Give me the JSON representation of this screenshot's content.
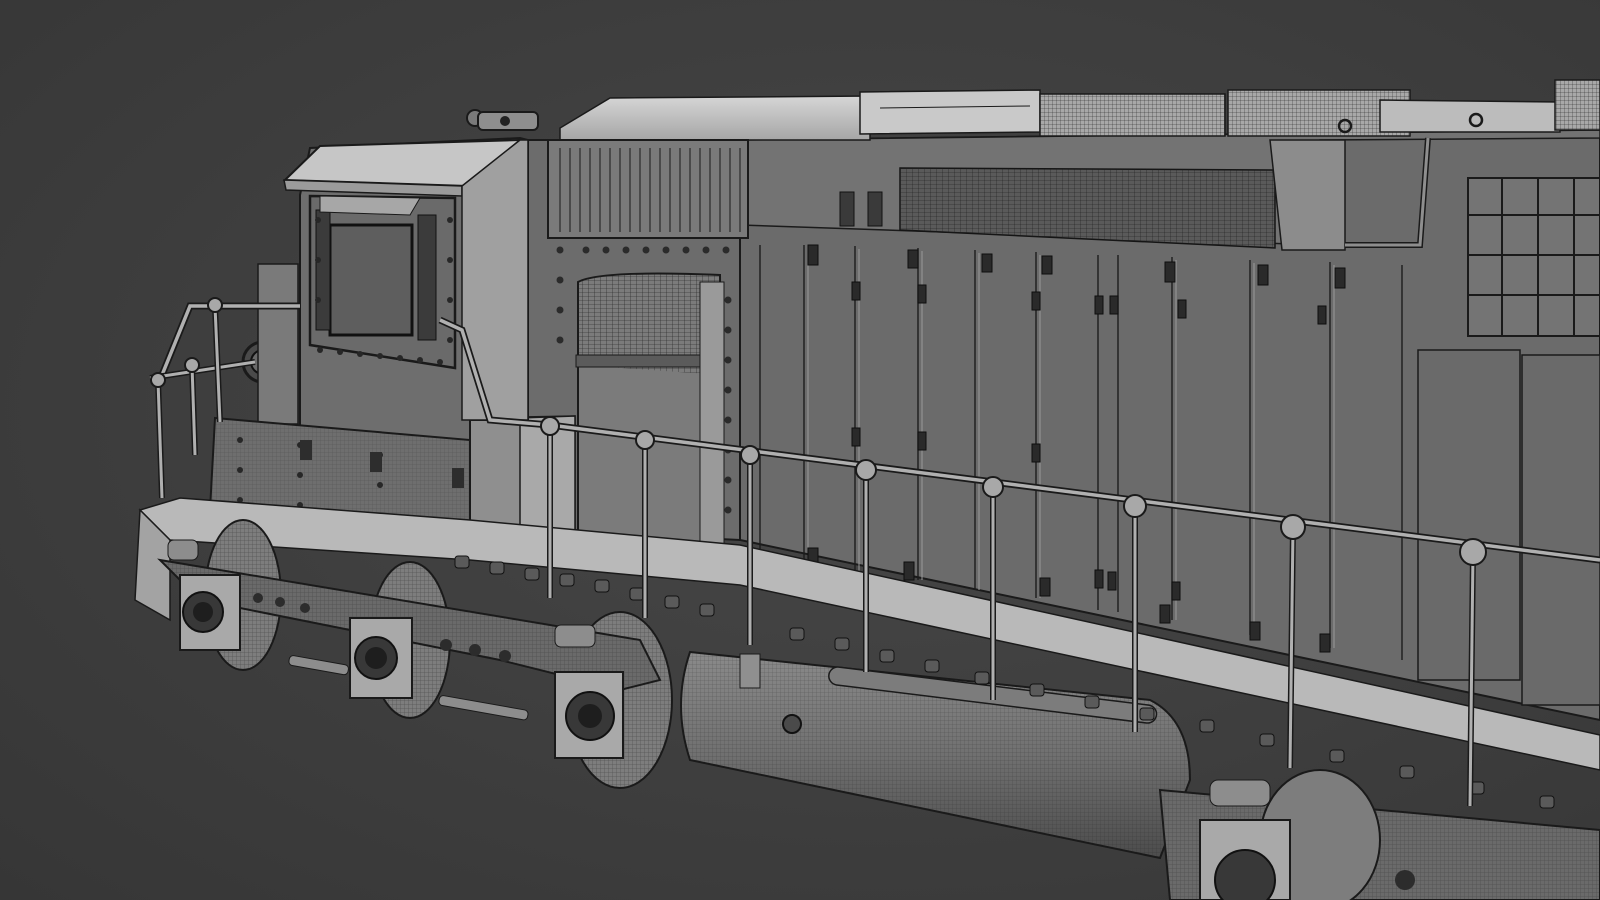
{
  "scene": {
    "subject": "locomotive-wireframe-render",
    "background_color": "#3d3d3d",
    "body_color": "#6e6e6e",
    "roof_color": "#bdbdbd",
    "wire_color": "#1a1a1a",
    "text": []
  }
}
